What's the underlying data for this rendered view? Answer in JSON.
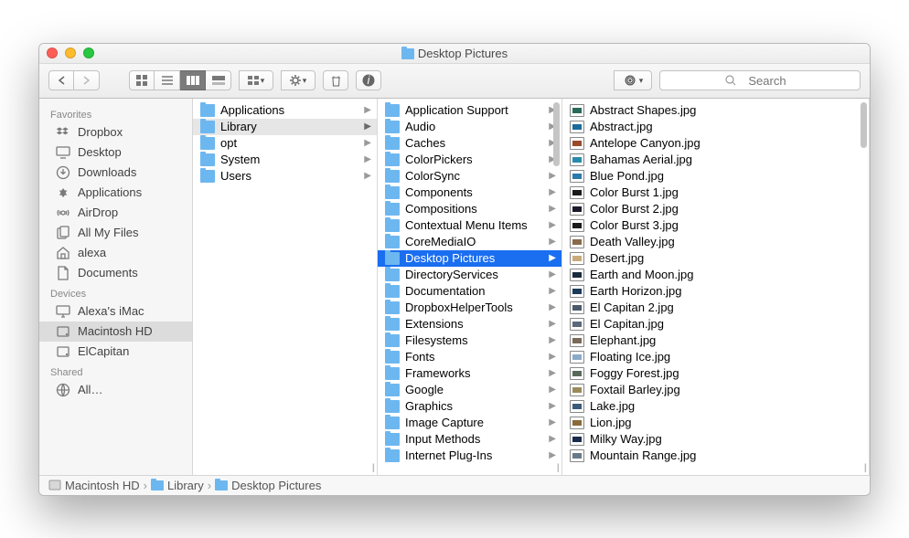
{
  "window": {
    "title": "Desktop Pictures"
  },
  "toolbar": {
    "search_placeholder": "Search"
  },
  "sidebar": {
    "sections": [
      {
        "header": "Favorites",
        "items": [
          {
            "label": "Dropbox",
            "icon": "dropbox"
          },
          {
            "label": "Desktop",
            "icon": "desktop"
          },
          {
            "label": "Downloads",
            "icon": "downloads"
          },
          {
            "label": "Applications",
            "icon": "applications"
          },
          {
            "label": "AirDrop",
            "icon": "airdrop"
          },
          {
            "label": "All My Files",
            "icon": "allfiles"
          },
          {
            "label": "alexa",
            "icon": "home"
          },
          {
            "label": "Documents",
            "icon": "documents"
          }
        ]
      },
      {
        "header": "Devices",
        "items": [
          {
            "label": "Alexa's iMac",
            "icon": "imac"
          },
          {
            "label": "Macintosh HD",
            "icon": "hdd",
            "selected": true
          },
          {
            "label": "ElCapitan",
            "icon": "hdd"
          }
        ]
      },
      {
        "header": "Shared",
        "items": [
          {
            "label": "All…",
            "icon": "network"
          }
        ]
      }
    ]
  },
  "columns": [
    {
      "items": [
        {
          "label": "Applications",
          "type": "folder",
          "arrow": true
        },
        {
          "label": "Library",
          "type": "folder",
          "arrow": true,
          "selected": true
        },
        {
          "label": "opt",
          "type": "folder",
          "arrow": true
        },
        {
          "label": "System",
          "type": "folder",
          "arrow": true
        },
        {
          "label": "Users",
          "type": "folder",
          "arrow": true
        }
      ]
    },
    {
      "items": [
        {
          "label": "Application Support",
          "type": "folder",
          "arrow": true
        },
        {
          "label": "Audio",
          "type": "folder",
          "arrow": true
        },
        {
          "label": "Caches",
          "type": "folder",
          "arrow": true
        },
        {
          "label": "ColorPickers",
          "type": "folder",
          "arrow": true
        },
        {
          "label": "ColorSync",
          "type": "folder",
          "arrow": true
        },
        {
          "label": "Components",
          "type": "folder",
          "arrow": true
        },
        {
          "label": "Compositions",
          "type": "folder",
          "arrow": true
        },
        {
          "label": "Contextual Menu Items",
          "type": "folder",
          "arrow": true
        },
        {
          "label": "CoreMediaIO",
          "type": "folder",
          "arrow": true
        },
        {
          "label": "Desktop Pictures",
          "type": "folder",
          "arrow": true,
          "highlight": true
        },
        {
          "label": "DirectoryServices",
          "type": "folder",
          "arrow": true
        },
        {
          "label": "Documentation",
          "type": "folder",
          "arrow": true
        },
        {
          "label": "DropboxHelperTools",
          "type": "folder",
          "arrow": true
        },
        {
          "label": "Extensions",
          "type": "folder",
          "arrow": true
        },
        {
          "label": "Filesystems",
          "type": "folder",
          "arrow": true
        },
        {
          "label": "Fonts",
          "type": "folder",
          "arrow": true
        },
        {
          "label": "Frameworks",
          "type": "folder",
          "arrow": true
        },
        {
          "label": "Google",
          "type": "folder",
          "arrow": true
        },
        {
          "label": "Graphics",
          "type": "folder",
          "arrow": true
        },
        {
          "label": "Image Capture",
          "type": "folder",
          "arrow": true
        },
        {
          "label": "Input Methods",
          "type": "folder",
          "arrow": true
        },
        {
          "label": "Internet Plug-Ins",
          "type": "folder",
          "arrow": true
        }
      ],
      "scrollbar": true
    },
    {
      "items": [
        {
          "label": "Abstract Shapes.jpg",
          "type": "image",
          "color": "#2a6a5a"
        },
        {
          "label": "Abstract.jpg",
          "type": "image",
          "color": "#1a6a9a"
        },
        {
          "label": "Antelope Canyon.jpg",
          "type": "image",
          "color": "#9a4a2a"
        },
        {
          "label": "Bahamas Aerial.jpg",
          "type": "image",
          "color": "#2a8aaa"
        },
        {
          "label": "Blue Pond.jpg",
          "type": "image",
          "color": "#2a7aaa"
        },
        {
          "label": "Color Burst 1.jpg",
          "type": "image",
          "color": "#1a1a1a"
        },
        {
          "label": "Color Burst 2.jpg",
          "type": "image",
          "color": "#1a1a2a"
        },
        {
          "label": "Color Burst 3.jpg",
          "type": "image",
          "color": "#1a1a1a"
        },
        {
          "label": "Death Valley.jpg",
          "type": "image",
          "color": "#8a6a4a"
        },
        {
          "label": "Desert.jpg",
          "type": "image",
          "color": "#caaa7a"
        },
        {
          "label": "Earth and Moon.jpg",
          "type": "image",
          "color": "#1a2a3a"
        },
        {
          "label": "Earth Horizon.jpg",
          "type": "image",
          "color": "#1a3a5a"
        },
        {
          "label": "El Capitan 2.jpg",
          "type": "image",
          "color": "#4a5a6a"
        },
        {
          "label": "El Capitan.jpg",
          "type": "image",
          "color": "#5a6a7a"
        },
        {
          "label": "Elephant.jpg",
          "type": "image",
          "color": "#7a6a5a"
        },
        {
          "label": "Floating Ice.jpg",
          "type": "image",
          "color": "#8aaaca"
        },
        {
          "label": "Foggy Forest.jpg",
          "type": "image",
          "color": "#5a6a5a"
        },
        {
          "label": "Foxtail Barley.jpg",
          "type": "image",
          "color": "#9a8a5a"
        },
        {
          "label": "Lake.jpg",
          "type": "image",
          "color": "#3a5a7a"
        },
        {
          "label": "Lion.jpg",
          "type": "image",
          "color": "#8a6a3a"
        },
        {
          "label": "Milky Way.jpg",
          "type": "image",
          "color": "#1a2a4a"
        },
        {
          "label": "Mountain Range.jpg",
          "type": "image",
          "color": "#6a7a8a"
        }
      ],
      "scrollbar": "small"
    }
  ],
  "pathbar": [
    {
      "label": "Macintosh HD",
      "icon": "hdd"
    },
    {
      "label": "Library",
      "icon": "folder"
    },
    {
      "label": "Desktop Pictures",
      "icon": "folder"
    }
  ]
}
